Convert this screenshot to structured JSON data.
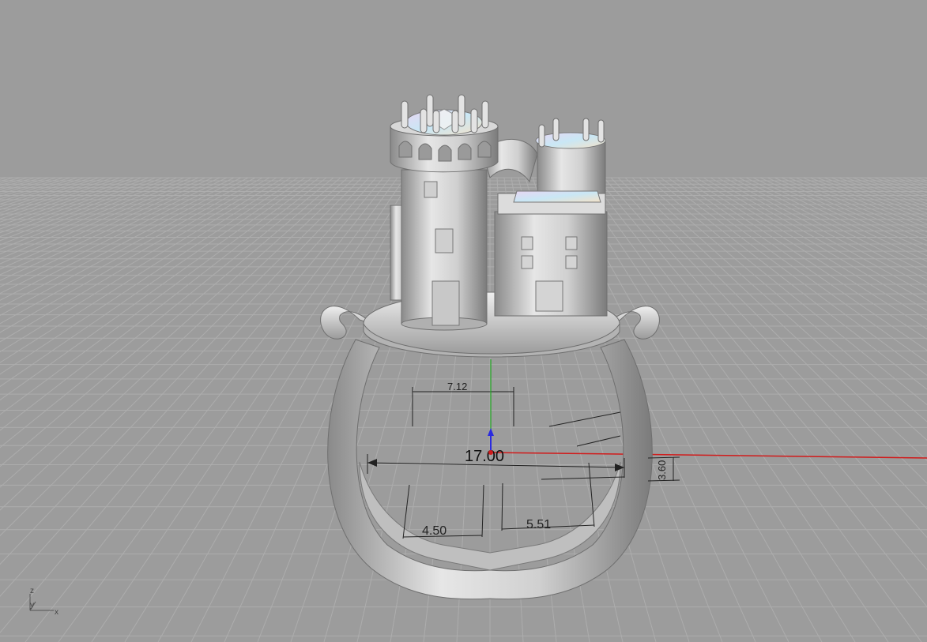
{
  "viewport": {
    "background": "#9c9c9c",
    "grid_color": "#adadad",
    "model": "castle-ring",
    "gem_colors": [
      "#e8d6f2",
      "#c9e7f5",
      "#f4e2c8"
    ]
  },
  "dimensions": {
    "top_width": "7.12",
    "ring_diameter": "17.00",
    "shank_height": "3.60",
    "left_band": "4.50",
    "right_band": "5.51"
  },
  "axes": {
    "x_color": "#d11b1b",
    "y_color": "#1ea51e",
    "z_color": "#2a2ae0",
    "triad_labels": {
      "z": "z",
      "y": "y",
      "x": "x"
    }
  }
}
